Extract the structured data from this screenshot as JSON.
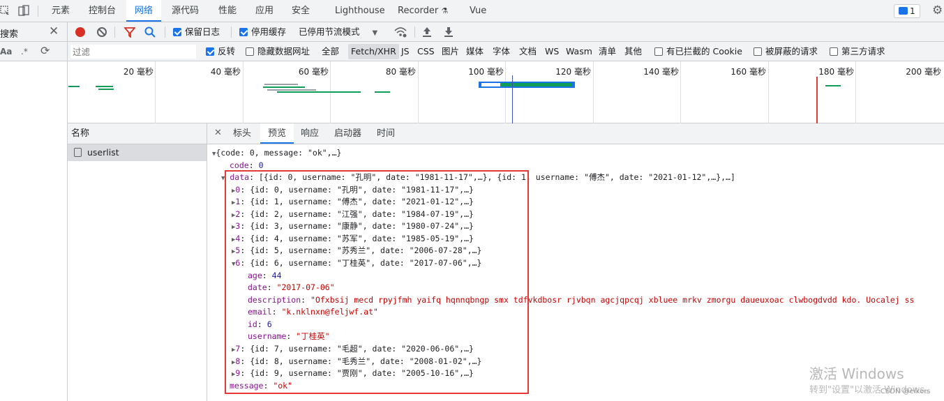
{
  "topbar": {
    "tabs": [
      "元素",
      "控制台",
      "网络",
      "源代码",
      "性能",
      "应用",
      "安全",
      "Lighthouse",
      "Recorder",
      "Vue"
    ],
    "badge_count": "1"
  },
  "search": {
    "label": "搜索",
    "aa": "Aa",
    "regex": ".*"
  },
  "toolbar1": {
    "preserve_log": "保留日志",
    "disable_cache": "停用缓存",
    "throttle": "已停用节流模式"
  },
  "toolbar2": {
    "filter_placeholder": "过滤",
    "invert": "反转",
    "hide_data_urls": "隐藏数据网址",
    "types": [
      "全部",
      "Fetch/XHR",
      "JS",
      "CSS",
      "图片",
      "媒体",
      "字体",
      "文档",
      "WS",
      "Wasm",
      "清单",
      "其他"
    ],
    "blocked_cookies": "有已拦截的 Cookie",
    "blocked_requests": "被屏蔽的请求",
    "third_party": "第三方请求"
  },
  "overview": {
    "ticks": [
      "20 毫秒",
      "40 毫秒",
      "60 毫秒",
      "80 毫秒",
      "100 毫秒",
      "120 毫秒",
      "140 毫秒",
      "160 毫秒",
      "180 毫秒",
      "200 毫秒"
    ]
  },
  "requests": {
    "header": "名称",
    "rows": [
      "userlist"
    ]
  },
  "detail": {
    "tabs": [
      "标头",
      "预览",
      "响应",
      "启动器",
      "时间"
    ]
  },
  "preview": {
    "root_summary": "{code: 0, message: \"ok\",…}",
    "code_key": "code",
    "code_val": "0",
    "data_key": "data",
    "data_summary": "[{id: 0, username: \"孔明\", date: \"1981-11-17\",…}, {id: 1, username: \"傅杰\", date: \"2021-01-12\",…},…]",
    "items": [
      {
        "idx": "0",
        "summary": "{id: 0, username: \"孔明\", date: \"1981-11-17\",…}"
      },
      {
        "idx": "1",
        "summary": "{id: 1, username: \"傅杰\", date: \"2021-01-12\",…}"
      },
      {
        "idx": "2",
        "summary": "{id: 2, username: \"江强\", date: \"1984-07-19\",…}"
      },
      {
        "idx": "3",
        "summary": "{id: 3, username: \"康静\", date: \"1980-07-24\",…}"
      },
      {
        "idx": "4",
        "summary": "{id: 4, username: \"苏军\", date: \"1985-05-19\",…}"
      },
      {
        "idx": "5",
        "summary": "{id: 5, username: \"苏秀兰\", date: \"2006-07-28\",…}"
      },
      {
        "idx": "6",
        "summary": "{id: 6, username: \"丁桂英\", date: \"2017-07-06\",…}"
      },
      {
        "idx": "7",
        "summary": "{id: 7, username: \"毛超\", date: \"2020-06-06\",…}"
      },
      {
        "idx": "8",
        "summary": "{id: 8, username: \"毛秀兰\", date: \"2008-01-02\",…}"
      },
      {
        "idx": "9",
        "summary": "{id: 9, username: \"贾刚\", date: \"2005-10-16\",…}"
      }
    ],
    "expanded": {
      "age": "44",
      "date": "\"2017-07-06\"",
      "description": "\"Ofxbsij mecd rpyjfmh yaifq hqnnqbngp smx tdfvkdbosr rjvbqn agcjqpcqj xbluee mrkv zmorgu daueuxoac clwbogdvdd kdo. Uocalej ss",
      "email": "\"k.nklnxn@feljwf.at\"",
      "id": "6",
      "username": "\"丁桂英\""
    },
    "message_key": "message",
    "message_val": "\"ok\""
  },
  "watermark": {
    "line1": "激活 Windows",
    "line2": "转到\"设置\"以激活 Windows。",
    "csdn": "CSDN @eikers"
  },
  "colors": {
    "accent": "#1a73e8",
    "highlight_box": "#e53935",
    "string": "#c80000",
    "key": "#881391"
  }
}
